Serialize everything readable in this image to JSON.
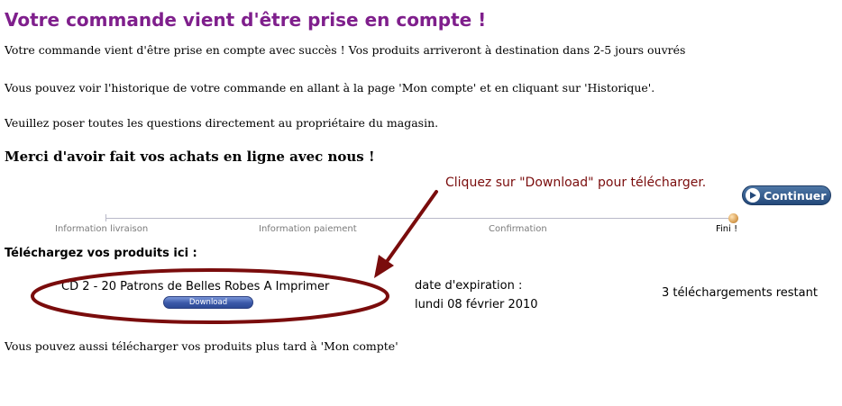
{
  "page": {
    "title": "Votre commande vient d'être prise en compte !",
    "paragraphs": [
      "Votre commande vient d'être prise en compte avec succès ! Vos produits arriveront à destination dans 2-5 jours ouvrés",
      "Vous pouvez voir l'historique de votre commande en allant à la page 'Mon compte' et en cliquant sur 'Historique'.",
      "Veuillez poser toutes les questions directement au propriétaire du magasin."
    ],
    "thanks": "Merci d'avoir fait vos achats en ligne avec nous !"
  },
  "annotation": {
    "text": "Cliquez sur \"Download\" pour télécharger.",
    "color": "#7a0c0c"
  },
  "continue_button": {
    "label": "Continuer",
    "icon": "arrow-right-icon"
  },
  "checkout_steps": [
    {
      "label": "Information livraison",
      "active": false
    },
    {
      "label": "Information paiement",
      "active": false
    },
    {
      "label": "Confirmation",
      "active": false
    },
    {
      "label": "Fini !",
      "active": true
    }
  ],
  "downloads": {
    "heading": "Téléchargez vos produits ici :",
    "items": [
      {
        "name": "CD 2 - 20 Patrons de Belles Robes A Imprimer",
        "button_label": "Download",
        "expiry_label": "date d'expiration :",
        "expiry_date": "lundi 08 février 2010",
        "remaining": "3 téléchargements restant"
      }
    ],
    "later_text": "Vous pouvez aussi télécharger vos produits plus tard à 'Mon compte'"
  },
  "colors": {
    "title": "#7f1f8c",
    "button_blue": "#2d5286",
    "annotation_red": "#7a0c0c"
  }
}
